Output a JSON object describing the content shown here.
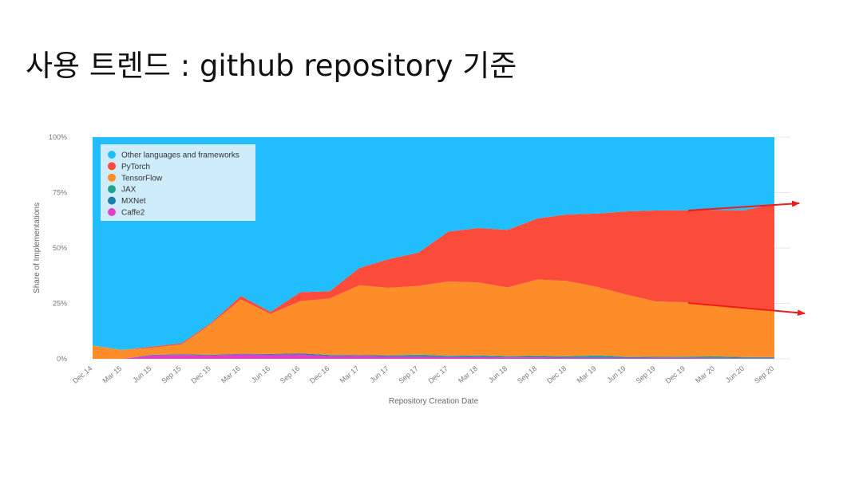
{
  "slide": {
    "title": "사용 트렌드 : github repository 기준"
  },
  "chart_data": {
    "type": "area",
    "stacking": "percent",
    "xlabel": "Repository Creation Date",
    "ylabel": "Share of Implementations",
    "ylim": [
      0,
      100
    ],
    "y_ticks": [
      "0%",
      "25%",
      "50%",
      "75%",
      "100%"
    ],
    "categories": [
      "Dec 14",
      "Mar 15",
      "Jun 15",
      "Sep 15",
      "Dec 15",
      "Mar 16",
      "Jun 16",
      "Sep 16",
      "Dec 16",
      "Mar 17",
      "Jun 17",
      "Sep 17",
      "Dec 17",
      "Mar 18",
      "Jun 18",
      "Sep 18",
      "Dec 18",
      "Mar 19",
      "Jun 19",
      "Sep 19",
      "Dec 19",
      "Mar 20",
      "Jun 20",
      "Sep 20"
    ],
    "legend_position": "top-left",
    "grid": true,
    "series": [
      {
        "name": "Caffe2",
        "color": "#e040c8",
        "values": [
          0,
          0,
          1.5,
          1.8,
          1.5,
          2,
          1.8,
          2,
          1.2,
          1.3,
          1,
          1,
          0.8,
          0.8,
          0.6,
          0.6,
          0.5,
          0.5,
          0.4,
          0.4,
          0.4,
          0.3,
          0.3,
          0.3
        ]
      },
      {
        "name": "MXNet",
        "color": "#1b7fa8",
        "values": [
          0,
          0,
          0.3,
          0.3,
          0.3,
          0.3,
          0.4,
          0.5,
          0.5,
          0.4,
          0.5,
          0.5,
          0.4,
          0.5,
          0.4,
          0.5,
          0.4,
          0.5,
          0.4,
          0.3,
          0.3,
          0.3,
          0.2,
          0.2
        ]
      },
      {
        "name": "JAX",
        "color": "#19a58e",
        "values": [
          0,
          0,
          0,
          0,
          0,
          0,
          0,
          0,
          0,
          0,
          0,
          0.4,
          0.2,
          0.2,
          0.2,
          0.2,
          0.2,
          0.5,
          0.2,
          0.2,
          0.3,
          0.5,
          0.3,
          0.3
        ]
      },
      {
        "name": "TensorFlow",
        "color": "#fd8d29",
        "values": [
          6,
          4,
          3.2,
          4.4,
          14,
          24.5,
          18,
          23.5,
          25.5,
          31.5,
          30.5,
          31,
          33.5,
          33,
          31,
          34.5,
          34,
          31,
          28,
          25,
          24.5,
          23,
          22.2,
          21
        ]
      },
      {
        "name": "PyTorch",
        "color": "#fb4c3b",
        "values": [
          0,
          0,
          0.5,
          0.5,
          0.5,
          1.5,
          1,
          4,
          3.3,
          7.8,
          13,
          15,
          22.5,
          24.5,
          26,
          27.5,
          30,
          33,
          37.5,
          41,
          41.5,
          43,
          44,
          48.2
        ]
      },
      {
        "name": "Other languages and frameworks",
        "color": "#21bdfd",
        "values": [
          94,
          96,
          94.5,
          93,
          83.7,
          71.7,
          78.8,
          70,
          69.5,
          59,
          55,
          52.1,
          42.6,
          41,
          41.8,
          36.7,
          34.9,
          34.5,
          33.5,
          33.1,
          33,
          32.9,
          33,
          30
        ]
      }
    ]
  }
}
